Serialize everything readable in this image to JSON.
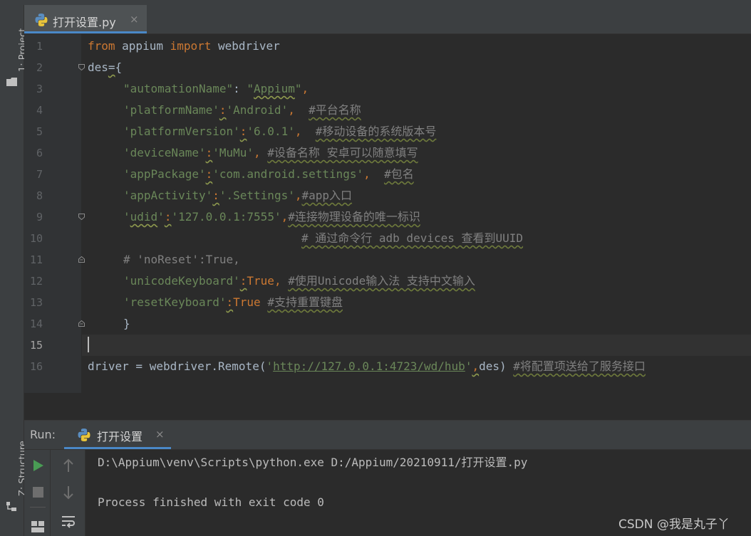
{
  "sidebar": {
    "project_label": "1: Project",
    "structure_label": "Z: Structure"
  },
  "editor": {
    "tab_title": "打开设置.py",
    "tab_close": "×",
    "line_numbers": [
      "1",
      "2",
      "3",
      "4",
      "5",
      "6",
      "7",
      "8",
      "9",
      "10",
      "11",
      "12",
      "13",
      "14",
      "15",
      "16"
    ],
    "current_line": "15",
    "code": {
      "l1_kw_from": "from",
      "l1_mod": " appium ",
      "l1_kw_import": "import",
      "l1_name": " webdriver",
      "l2_des": "des",
      "l2_eq": "=",
      "l2_brace": "{",
      "l3_key": "\"automationName\"",
      "l3_colon": ": ",
      "l3_q1": "\"",
      "l3_val": "Appium",
      "l3_q2": "\"",
      "l3_comma": ",",
      "l4_key": "'platformName'",
      "l4_colon": ":",
      "l4_val": "'Android'",
      "l4_comma": ",  ",
      "l4_comment": "#平台名称",
      "l5_key": "'platformVersion'",
      "l5_colon": ":",
      "l5_val": "'6.0.1'",
      "l5_comma": ",  ",
      "l5_comment": "#移动设备的系统版本号",
      "l6_key": "'deviceName'",
      "l6_colon": ":",
      "l6_val": "'MuMu'",
      "l6_comma": ", ",
      "l6_comment": "#设备名称 安卓可以随意填写",
      "l7_key": "'appPackage'",
      "l7_colon": ":",
      "l7_val": "'com.android.settings'",
      "l7_comma": ",  ",
      "l7_comment": "#包名",
      "l8_key": "'appActivity'",
      "l8_colon": ":",
      "l8_val": "'.Settings'",
      "l8_comma": ",",
      "l8_comment": "#app入口",
      "l9_q1": "'",
      "l9_key": "udid",
      "l9_q2": "'",
      "l9_colon": ":",
      "l9_val": "'127.0.0.1:7555'",
      "l9_comma": ",",
      "l9_comment": "#连接物理设备的唯一标识",
      "l10_comment": "# 通过命令行 adb devices 查看到UUID",
      "l11_comment": "# 'noReset':True,",
      "l12_key": "'unicodeKeyboard'",
      "l12_colon": ":",
      "l12_val": "True",
      "l12_comma": ", ",
      "l12_comment": "#使用Unicode输入法 支持中文输入",
      "l13_key": "'resetKeyboard'",
      "l13_colon": ":",
      "l13_val": "True",
      "l13_sp": " ",
      "l13_comment": "#支持重置键盘",
      "l14_brace": "}",
      "l16_pre": "driver = webdriver.Remote(",
      "l16_q1": "'",
      "l16_url": "http://127.0.0.1:4723/wd/hub",
      "l16_q2": "'",
      "l16_comma": ",",
      "l16_post": "des) ",
      "l16_comment": "#将配置项送给了服务接口"
    }
  },
  "run": {
    "label": "Run:",
    "tab_title": "打开设置",
    "tab_close": "×",
    "console_line1": "D:\\Appium\\venv\\Scripts\\python.exe D:/Appium/20210911/打开设置.py",
    "console_line2": "Process finished with exit code 0"
  },
  "watermark": "CSDN @我是丸子丫",
  "colors": {
    "keyword": "#cc7832",
    "string": "#6a8759",
    "comment": "#808080",
    "accent": "#4a88c7",
    "run_green": "#499c54"
  }
}
